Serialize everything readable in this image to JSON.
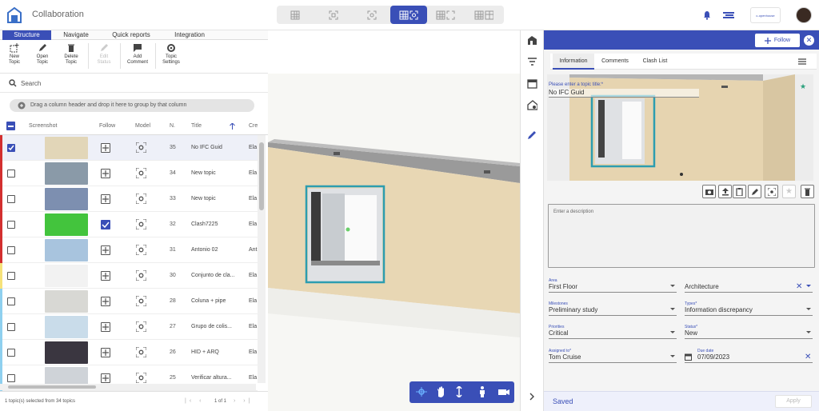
{
  "app": {
    "title": "Collaboration",
    "brand_text": "c-openhouse"
  },
  "viewbar": {
    "buttons": [
      "grid-view-icon",
      "frame-view-icon",
      "focus-view-icon",
      "grid-focus-view-icon",
      "split-view-icon",
      "grid-split-view-icon"
    ],
    "active_index": 3
  },
  "left_tabs": [
    "Structure",
    "Navigate",
    "Quick reports",
    "Integration"
  ],
  "toolbar": {
    "new_topic": "New\nTopic",
    "open_topic": "Open\nTopic",
    "delete_topic": "Delete\nTopic",
    "edit_status": "Edit\nStatus",
    "add_comment": "Add\nComment",
    "topic_settings": "Topic\nSettings"
  },
  "search": {
    "placeholder": "Search"
  },
  "groupbar": {
    "text": "Drag a column header and drop it here to group by that column"
  },
  "table": {
    "headers": {
      "screenshot": "Screenshot",
      "follow": "Follow",
      "model": "Model",
      "n": "N.",
      "title": "Title",
      "creator": "Cre"
    },
    "rows": [
      {
        "n": "35",
        "title": "No IFC Guid",
        "creator": "Ela",
        "checked": true,
        "follow": false,
        "tag": "#d32f2f",
        "shot": "#e2d6b8"
      },
      {
        "n": "34",
        "title": "New topic",
        "creator": "Ela",
        "checked": false,
        "follow": false,
        "tag": "#d32f2f",
        "shot": "#8a9aa8"
      },
      {
        "n": "33",
        "title": "New topic",
        "creator": "Ela",
        "checked": false,
        "follow": false,
        "tag": "#d32f2f",
        "shot": "#7d8fb0"
      },
      {
        "n": "32",
        "title": "Clash7225",
        "creator": "Ela",
        "checked": false,
        "follow": true,
        "tag": "#d32f2f",
        "shot": "#43c43d"
      },
      {
        "n": "31",
        "title": "Antonio 02",
        "creator": "Ant",
        "checked": false,
        "follow": false,
        "tag": "#d32f2f",
        "shot": "#a8c4de"
      },
      {
        "n": "30",
        "title": "Conjunto de cla...",
        "creator": "Ela",
        "checked": false,
        "follow": false,
        "tag": "#f6e27a",
        "shot": "#f2f2f2"
      },
      {
        "n": "28",
        "title": "Coluna + pipe",
        "creator": "Ela",
        "checked": false,
        "follow": false,
        "tag": "#8fd0ef",
        "shot": "#d8d8d4"
      },
      {
        "n": "27",
        "title": "Grupo de colis...",
        "creator": "Ela",
        "checked": false,
        "follow": false,
        "tag": "#8fd0ef",
        "shot": "#c9dcea"
      },
      {
        "n": "26",
        "title": "HID + ARQ",
        "creator": "Ela",
        "checked": false,
        "follow": false,
        "tag": "#8fd0ef",
        "shot": "#3a3640"
      },
      {
        "n": "25",
        "title": "Verificar altura...",
        "creator": "Ela",
        "checked": false,
        "follow": false,
        "tag": "#8fd0ef",
        "shot": "#cfd3d8"
      }
    ]
  },
  "footer": {
    "selection": "1 topic(s) selected from 34 topics",
    "page_info": "1 of 1"
  },
  "panel": {
    "title": "No IFC Guid",
    "follow_label": "Follow",
    "tabs": [
      "Information",
      "Comments",
      "Clash List"
    ],
    "topic_title_label": "Please enter a topic title:*",
    "topic_title_value": "No IFC Guid",
    "description_placeholder": "Enter a description",
    "fields": {
      "area": {
        "label": "Area",
        "value": "First Floor"
      },
      "discipline": {
        "label": "",
        "value": "Architecture"
      },
      "milestones": {
        "label": "Milestones",
        "value": "Preliminary study"
      },
      "types": {
        "label": "Types*",
        "value": "Information discrepancy"
      },
      "priorities": {
        "label": "Priorities",
        "value": "Critical"
      },
      "status": {
        "label": "Status*",
        "value": "New"
      },
      "assigned": {
        "label": "Assigned to*",
        "value": "Tom Cruise"
      },
      "due": {
        "label": "Due date",
        "value": "07/09/2023"
      }
    },
    "saved": "Saved",
    "apply": "Apply"
  },
  "colors": {
    "accent": "#3a4fb7",
    "wall": "#e8d7b4",
    "window_frame": "#2c9db0"
  }
}
